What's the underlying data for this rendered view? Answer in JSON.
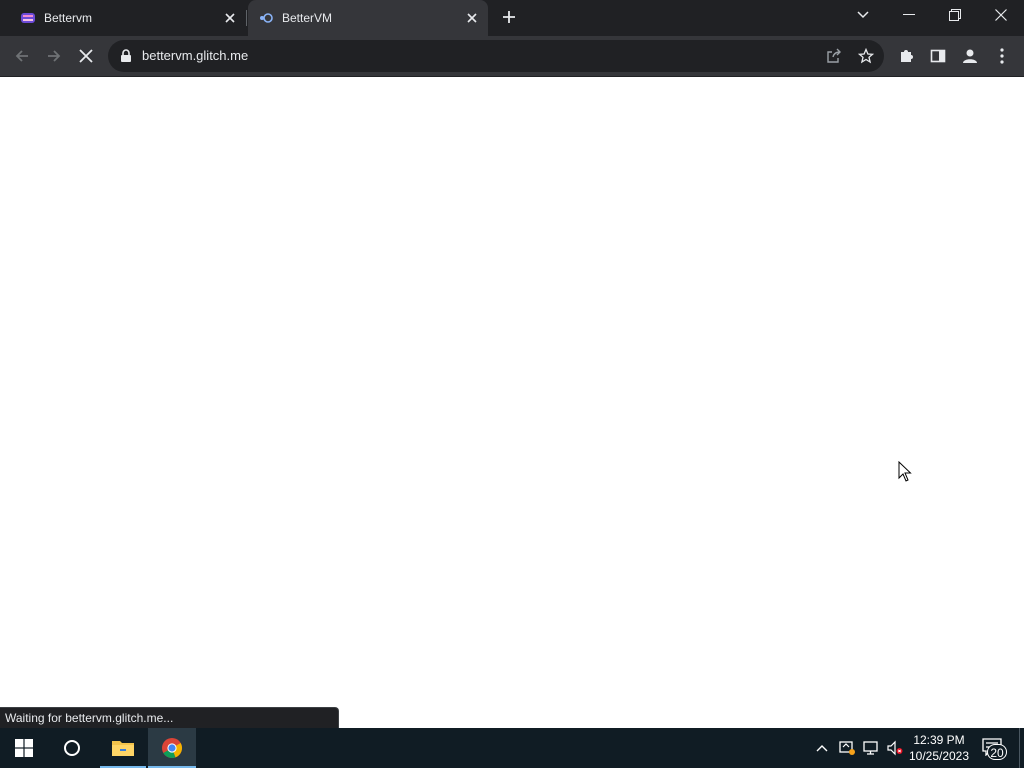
{
  "browser": {
    "tabs": [
      {
        "title": "Bettervm",
        "active": false
      },
      {
        "title": "BetterVM",
        "active": true
      }
    ],
    "url": "bettervm.glitch.me",
    "status_text": "Waiting for bettervm.glitch.me..."
  },
  "taskbar": {
    "time": "12:39 PM",
    "date": "10/25/2023",
    "notification_count": "20"
  },
  "colors": {
    "tabstrip": "#202124",
    "toolbar": "#35363a",
    "taskbar": "#101c24",
    "accent": "#76b9ed"
  }
}
